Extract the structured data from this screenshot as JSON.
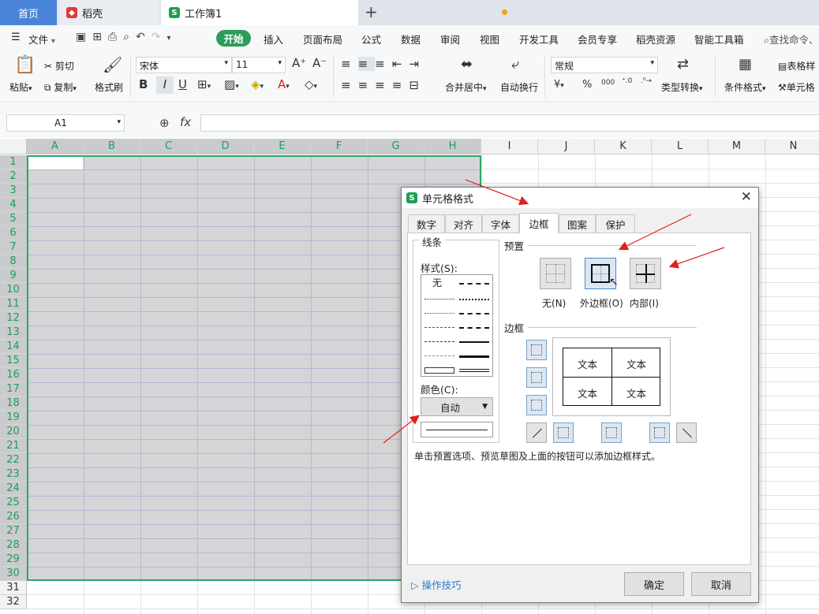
{
  "tabs": {
    "home": "首页",
    "daoke": "稻壳",
    "workbook": "工作簿1"
  },
  "menu": {
    "file": "文件",
    "items": [
      "开始",
      "插入",
      "页面布局",
      "公式",
      "数据",
      "审阅",
      "视图",
      "开发工具",
      "会员专享",
      "稻壳资源",
      "智能工具箱"
    ],
    "search": "查找命令、"
  },
  "ribbon": {
    "paste": "粘贴",
    "cut": "剪切",
    "copy": "复制",
    "format_painter": "格式刷",
    "font_name": "宋体",
    "font_size": "11",
    "merge_center": "合并居中",
    "wrap_text": "自动换行",
    "number_format": "常规",
    "type_convert": "类型转换",
    "cond_format": "条件格式",
    "table_style": "表格样",
    "cell_style": "单元格",
    "percent": "%",
    "thousands": "000"
  },
  "formula_bar": {
    "name_box": "A1",
    "fx": "fx"
  },
  "sheet": {
    "columns": [
      "A",
      "B",
      "C",
      "D",
      "E",
      "F",
      "G",
      "H",
      "I",
      "J",
      "K",
      "L",
      "M",
      "N"
    ],
    "rows": [
      "1",
      "2",
      "3",
      "4",
      "5",
      "6",
      "7",
      "8",
      "9",
      "10",
      "11",
      "12",
      "13",
      "14",
      "15",
      "16",
      "17",
      "18",
      "19",
      "20",
      "21",
      "22",
      "23",
      "24",
      "25",
      "26",
      "27",
      "28",
      "29",
      "30",
      "31",
      "32"
    ],
    "selected_columns": [
      "A",
      "B",
      "C",
      "D",
      "E",
      "F",
      "G",
      "H"
    ],
    "selected_rows_to": 30
  },
  "dialog": {
    "title": "单元格格式",
    "tabs": [
      "数字",
      "对齐",
      "字体",
      "边框",
      "图案",
      "保护"
    ],
    "active_tab": "边框",
    "line_group": "线条",
    "style_label": "样式(S):",
    "style_none": "无",
    "color_label": "颜色(C):",
    "color_value": "自动",
    "presets_group": "预置",
    "preset_none": "无(N)",
    "preset_outline": "外边框(O)",
    "preset_inside": "内部(I)",
    "border_group": "边框",
    "preview_text": [
      "文本",
      "文本",
      "文本",
      "文本"
    ],
    "hint": "单击预置选项、预览草图及上面的按钮可以添加边框样式。",
    "tips": "操作技巧",
    "ok": "确定",
    "cancel": "取消"
  },
  "colors": {
    "accent_green": "#2aa866",
    "tab_blue": "#4a84d8",
    "arrow_red": "#e0201c"
  }
}
